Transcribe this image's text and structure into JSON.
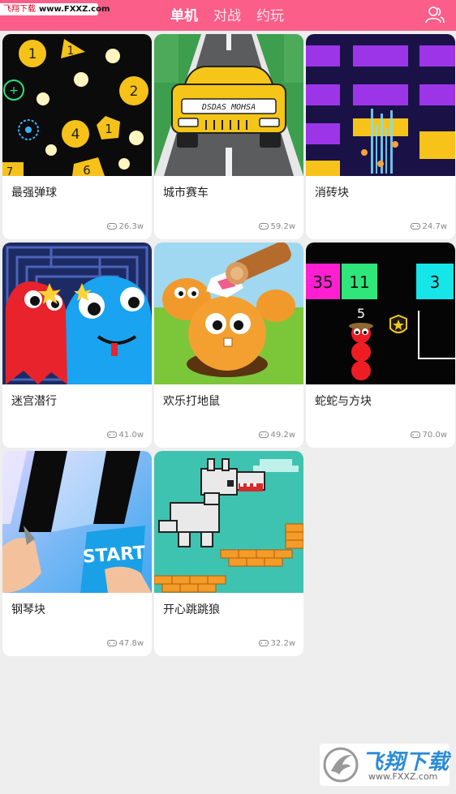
{
  "site_badge": {
    "brand": "飞翔下载",
    "url": "www.FXXZ.com"
  },
  "tabs": [
    {
      "label": "单机",
      "active": true
    },
    {
      "label": "对战",
      "active": false
    },
    {
      "label": "约玩",
      "active": false
    }
  ],
  "user_icon": "user-group-icon",
  "games": [
    {
      "title": "最强弹球",
      "plays": "26.3w",
      "art": {
        "numbers": [
          "1",
          "1",
          "2",
          "4",
          "1",
          "7",
          "6"
        ]
      }
    },
    {
      "title": "城市赛车",
      "plays": "59.2w",
      "art": {
        "plate": "DSDAS MOHSA"
      }
    },
    {
      "title": "消砖块",
      "plays": "24.7w"
    },
    {
      "title": "迷宫潜行",
      "plays": "41.0w"
    },
    {
      "title": "欢乐打地鼠",
      "plays": "49.2w"
    },
    {
      "title": "蛇蛇与方块",
      "plays": "70.0w",
      "art": {
        "blocks": [
          "35",
          "11",
          "3"
        ],
        "snake_length": "5"
      }
    },
    {
      "title": "钢琴块",
      "plays": "47.8w",
      "art": {
        "start": "START"
      }
    },
    {
      "title": "开心跳跳狼",
      "plays": "32.2w"
    }
  ],
  "watermark": {
    "cn": "飞翔下载",
    "url": "www.FXXZ.com"
  },
  "colors": {
    "header": "#fb5e89",
    "background": "#eeeeee",
    "card": "#ffffff"
  }
}
